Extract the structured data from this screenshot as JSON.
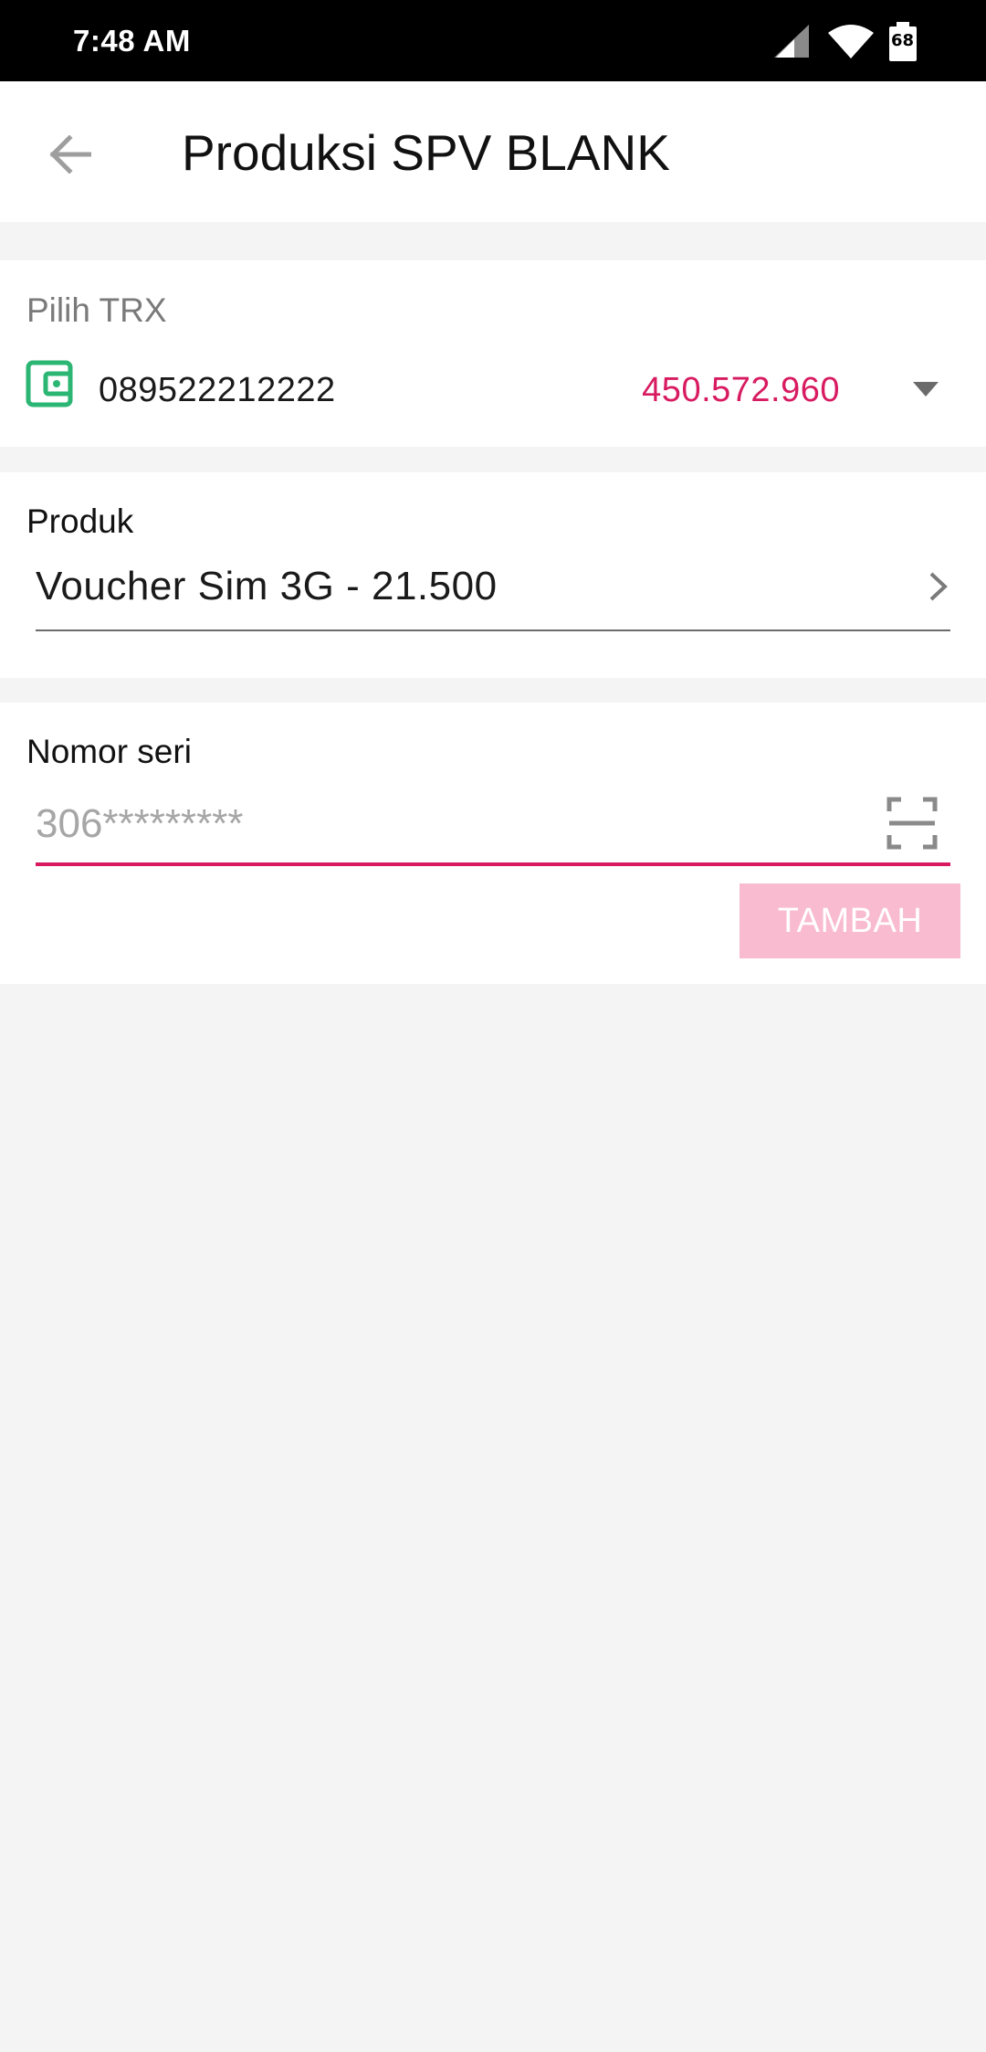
{
  "status_bar": {
    "time": "7:48 AM",
    "battery_level": "68",
    "icons": [
      "signal-icon",
      "wifi-icon",
      "battery-icon"
    ]
  },
  "app_bar": {
    "title": "Produksi SPV BLANK",
    "back_icon": "arrow-back-icon"
  },
  "trx": {
    "label": "Pilih TRX",
    "number": "089522212222",
    "balance": "450.572.960",
    "icon": "wallet-icon"
  },
  "produk": {
    "label": "Produk",
    "value": "Voucher Sim 3G - 21.500"
  },
  "nomor_seri": {
    "label": "Nomor seri",
    "placeholder": "306*********",
    "value": "",
    "scan_icon": "scan-icon"
  },
  "actions": {
    "tambah_label": "TAMBAH"
  },
  "colors": {
    "accent": "#d81b60",
    "accent_disabled": "#f8bbd0",
    "wallet_icon": "#2bb673",
    "background": "#f4f4f4"
  }
}
